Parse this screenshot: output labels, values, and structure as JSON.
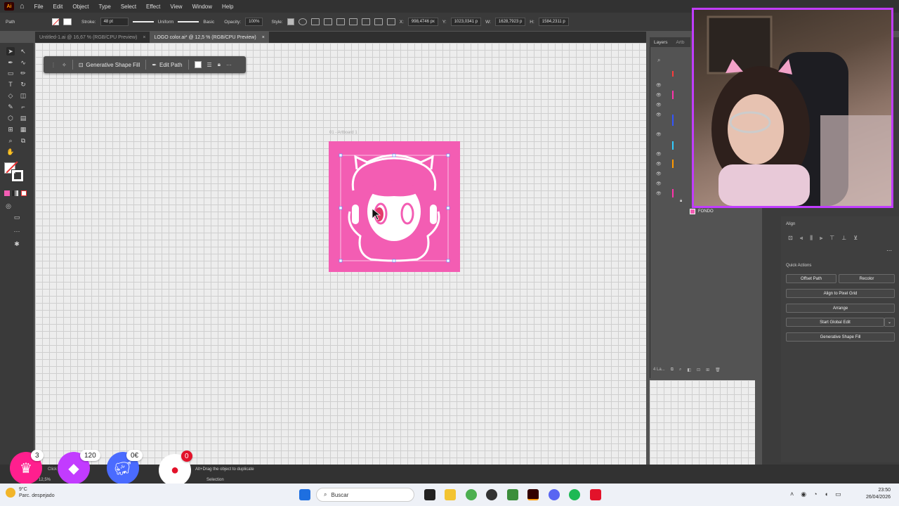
{
  "app": {
    "logo": "Ai",
    "menu": [
      "File",
      "Edit",
      "Object",
      "Type",
      "Select",
      "Effect",
      "View",
      "Window",
      "Help"
    ]
  },
  "control_bar": {
    "selection_type": "Path",
    "stroke_label": "Stroke:",
    "stroke_weight": "48 pt",
    "profile": "Uniform",
    "brush": "Basic",
    "opacity_label": "Opacity:",
    "opacity_value": "100%",
    "style_label": "Style:",
    "x_label": "X:",
    "x_value": "998,4746 px",
    "y_label": "Y:",
    "y_value": "1023,0341 p",
    "w_label": "W:",
    "w_value": "1628,7923 p",
    "h_label": "H:",
    "h_value": "1584,2311 p"
  },
  "tabs": [
    {
      "label": "Untitled-1.ai @ 16,67 % (RGB/CPU Preview)",
      "close": "×"
    },
    {
      "label": "LOGO color.ai* @ 12,5 % (RGB/CPU Preview)",
      "close": "×"
    }
  ],
  "context_bar": {
    "generative_label": "Generative Shape Fill",
    "edit_path_label": "Edit Path",
    "more": "···"
  },
  "artboard": {
    "label": "01 - Artboard 1",
    "color": "#f35db3"
  },
  "layers": {
    "tabs": [
      "Layers",
      "Artb"
    ],
    "fondo_label": "FONDO",
    "footer": "4 La..."
  },
  "properties": {
    "align_header": "Align",
    "quick_actions_header": "Quick Actions",
    "offset_path": "Offset Path",
    "recolor": "Recolor",
    "align_pixel_grid": "Align to Pixel Grid",
    "arrange": "Arrange",
    "start_global_edit": "Start Global Edit",
    "generative_shape_fill": "Generative Shape Fill"
  },
  "status": {
    "zoom": "12,5%",
    "hint": "Alt+Drag the object to duplicate",
    "tool": "Selection",
    "left_overlay": "Click to select"
  },
  "stream_badges": {
    "crown_count": "3",
    "gem_count": "120",
    "piggy_count": "0€",
    "bomb_count": "0"
  },
  "weather": {
    "temp": "9°C",
    "desc": "Parc. despejado"
  },
  "taskbar": {
    "search_placeholder": "Buscar",
    "time": "23:50",
    "date": "26/04/2026"
  }
}
